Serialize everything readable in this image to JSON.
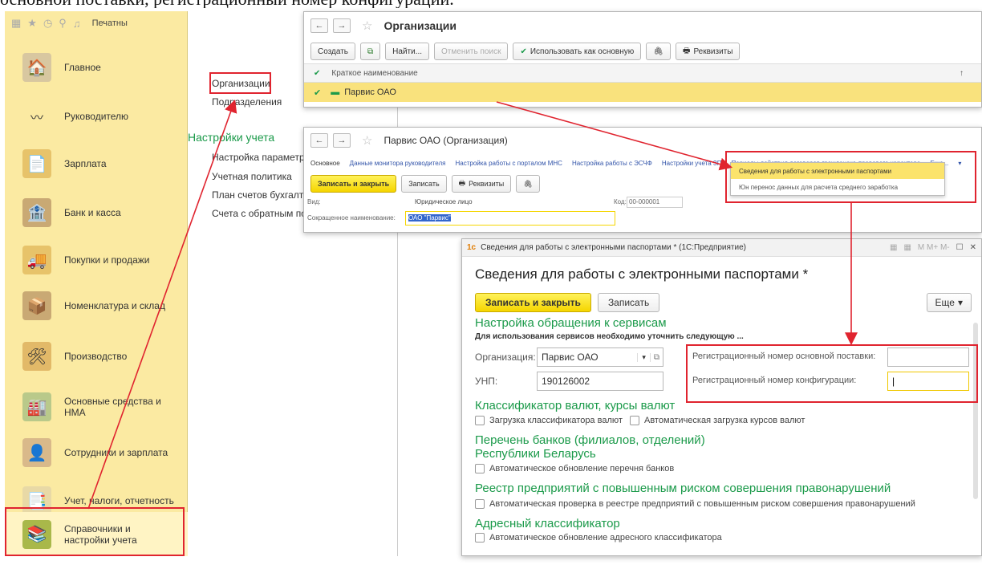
{
  "caption": "основной поставки, регистрационный номер конфигурации.",
  "sidebar": {
    "print_label": "Печатны",
    "items": [
      {
        "label": "Главное",
        "icon": "home-icon"
      },
      {
        "label": "Руководителю",
        "icon": "trend-icon"
      },
      {
        "label": "Зарплата",
        "icon": "payroll-icon"
      },
      {
        "label": "Банк и касса",
        "icon": "bank-icon"
      },
      {
        "label": "Покупки и продажи",
        "icon": "truck-icon"
      },
      {
        "label": "Номенклатура и склад",
        "icon": "warehouse-icon"
      },
      {
        "label": "Производство",
        "icon": "tools-icon"
      },
      {
        "label": "Основные средства и НМА",
        "icon": "assets-icon"
      },
      {
        "label": "Сотрудники и зарплата",
        "icon": "employee-icon"
      },
      {
        "label": "Учет, налоги, отчетность",
        "icon": "report-icon"
      },
      {
        "label": "Справочники и настройки учета",
        "icon": "folders-icon"
      }
    ]
  },
  "middle": {
    "links_top": [
      "Организации",
      "Подразделения"
    ],
    "section_title": "Настройки учета",
    "links_bottom": [
      "Настройка параметро",
      "Учетная политика",
      "План счетов бухгалте",
      "Счета с обратным по"
    ]
  },
  "win_orgs": {
    "title": "Организации",
    "toolbar": {
      "create": "Создать",
      "find": "Найти...",
      "cancel_search": "Отменить поиск",
      "use_main": "Использовать как основную",
      "requisites": "Реквизиты"
    },
    "column_header": "Краткое наименование",
    "sort_mark": "↑",
    "row": "Парвис ОАО"
  },
  "win_parvis": {
    "title": "Парвис ОАО (Организация)",
    "tabs": [
      "Основное",
      "Данные монитора руководителя",
      "Настройка работы с порталом МНС",
      "Настройка работы с ЭСЧФ",
      "Настройки учета ЗП",
      "Периоды действия договоров гражданско-правового характера",
      "Еще..."
    ],
    "save_close": "Записать и закрыть",
    "save": "Записать",
    "requisites": "Реквизиты",
    "kind_label": "Вид:",
    "kind_value": "Юридическое лицо",
    "code_label": "Код:",
    "code_value": "00-000001",
    "short_name_label": "Сокращенное наименование:",
    "short_name_value": "ОАО \"Парвис\"",
    "dropdown": [
      "Сведения для работы с электронными паспортами",
      "Юн перенос данных для расчета среднего заработка"
    ]
  },
  "win_epass": {
    "titlebar": "Сведения для работы с электронными паспортами * (1С:Предприятие)",
    "heading": "Сведения для работы с электронными паспортами *",
    "save_close": "Записать и закрыть",
    "save": "Записать",
    "more": "Еще",
    "sec1": "Настройка обращения к сервисам",
    "note": "Для использования сервисов необходимо уточнить следующую ...",
    "org_label": "Организация:",
    "org_value": "Парвис ОАО",
    "unp_label": "УНП:",
    "unp_value": "190126002",
    "reg_main_label": "Регистрационный номер основной поставки:",
    "reg_conf_label": "Регистрационный номер конфигурации:",
    "sec2": "Классификатор валют, курсы валют",
    "cb_currency_load": "Загрузка классификатора валют",
    "cb_currency_auto": "Автоматическая загрузка курсов валют",
    "sec3": "Перечень банков (филиалов, отделений) Республики Беларусь",
    "cb_banks": "Автоматическое обновление перечня банков",
    "sec4": "Реестр предприятий с повышенным риском совершения правонарушений",
    "cb_registry": "Автоматическая проверка в реестре предприятий с повышенным риском совершения правонарушений",
    "sec5": "Адресный классификатор",
    "cb_address": "Автоматическое обновление адресного классификатора",
    "title_icons": "M M+ M-"
  },
  "colors": {
    "accent_green": "#1b9a4a",
    "sidebar_bg": "#fbeaa2",
    "highlight_red": "#e0242f",
    "yellow_button": "#f5d500"
  }
}
